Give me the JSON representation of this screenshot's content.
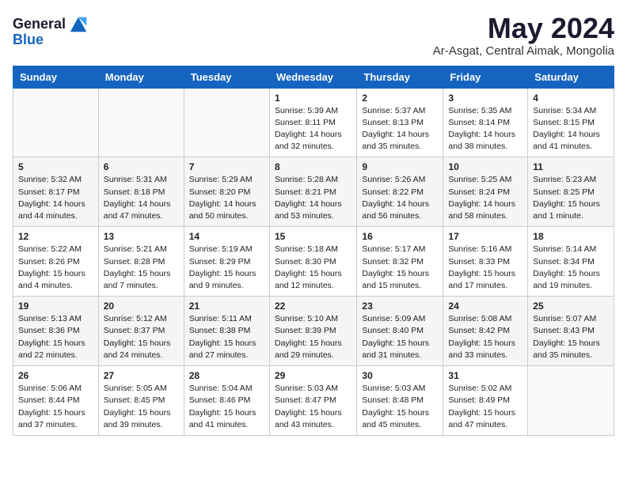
{
  "header": {
    "logo": {
      "general": "General",
      "blue": "Blue"
    },
    "title": "May 2024",
    "location": "Ar-Asgat, Central Aimak, Mongolia"
  },
  "calendar": {
    "days_of_week": [
      "Sunday",
      "Monday",
      "Tuesday",
      "Wednesday",
      "Thursday",
      "Friday",
      "Saturday"
    ],
    "weeks": [
      [
        {
          "day": "",
          "info": ""
        },
        {
          "day": "",
          "info": ""
        },
        {
          "day": "",
          "info": ""
        },
        {
          "day": "1",
          "info": "Sunrise: 5:39 AM\nSunset: 8:11 PM\nDaylight: 14 hours\nand 32 minutes."
        },
        {
          "day": "2",
          "info": "Sunrise: 5:37 AM\nSunset: 8:13 PM\nDaylight: 14 hours\nand 35 minutes."
        },
        {
          "day": "3",
          "info": "Sunrise: 5:35 AM\nSunset: 8:14 PM\nDaylight: 14 hours\nand 38 minutes."
        },
        {
          "day": "4",
          "info": "Sunrise: 5:34 AM\nSunset: 8:15 PM\nDaylight: 14 hours\nand 41 minutes."
        }
      ],
      [
        {
          "day": "5",
          "info": "Sunrise: 5:32 AM\nSunset: 8:17 PM\nDaylight: 14 hours\nand 44 minutes."
        },
        {
          "day": "6",
          "info": "Sunrise: 5:31 AM\nSunset: 8:18 PM\nDaylight: 14 hours\nand 47 minutes."
        },
        {
          "day": "7",
          "info": "Sunrise: 5:29 AM\nSunset: 8:20 PM\nDaylight: 14 hours\nand 50 minutes."
        },
        {
          "day": "8",
          "info": "Sunrise: 5:28 AM\nSunset: 8:21 PM\nDaylight: 14 hours\nand 53 minutes."
        },
        {
          "day": "9",
          "info": "Sunrise: 5:26 AM\nSunset: 8:22 PM\nDaylight: 14 hours\nand 56 minutes."
        },
        {
          "day": "10",
          "info": "Sunrise: 5:25 AM\nSunset: 8:24 PM\nDaylight: 14 hours\nand 58 minutes."
        },
        {
          "day": "11",
          "info": "Sunrise: 5:23 AM\nSunset: 8:25 PM\nDaylight: 15 hours\nand 1 minute."
        }
      ],
      [
        {
          "day": "12",
          "info": "Sunrise: 5:22 AM\nSunset: 8:26 PM\nDaylight: 15 hours\nand 4 minutes."
        },
        {
          "day": "13",
          "info": "Sunrise: 5:21 AM\nSunset: 8:28 PM\nDaylight: 15 hours\nand 7 minutes."
        },
        {
          "day": "14",
          "info": "Sunrise: 5:19 AM\nSunset: 8:29 PM\nDaylight: 15 hours\nand 9 minutes."
        },
        {
          "day": "15",
          "info": "Sunrise: 5:18 AM\nSunset: 8:30 PM\nDaylight: 15 hours\nand 12 minutes."
        },
        {
          "day": "16",
          "info": "Sunrise: 5:17 AM\nSunset: 8:32 PM\nDaylight: 15 hours\nand 15 minutes."
        },
        {
          "day": "17",
          "info": "Sunrise: 5:16 AM\nSunset: 8:33 PM\nDaylight: 15 hours\nand 17 minutes."
        },
        {
          "day": "18",
          "info": "Sunrise: 5:14 AM\nSunset: 8:34 PM\nDaylight: 15 hours\nand 19 minutes."
        }
      ],
      [
        {
          "day": "19",
          "info": "Sunrise: 5:13 AM\nSunset: 8:36 PM\nDaylight: 15 hours\nand 22 minutes."
        },
        {
          "day": "20",
          "info": "Sunrise: 5:12 AM\nSunset: 8:37 PM\nDaylight: 15 hours\nand 24 minutes."
        },
        {
          "day": "21",
          "info": "Sunrise: 5:11 AM\nSunset: 8:38 PM\nDaylight: 15 hours\nand 27 minutes."
        },
        {
          "day": "22",
          "info": "Sunrise: 5:10 AM\nSunset: 8:39 PM\nDaylight: 15 hours\nand 29 minutes."
        },
        {
          "day": "23",
          "info": "Sunrise: 5:09 AM\nSunset: 8:40 PM\nDaylight: 15 hours\nand 31 minutes."
        },
        {
          "day": "24",
          "info": "Sunrise: 5:08 AM\nSunset: 8:42 PM\nDaylight: 15 hours\nand 33 minutes."
        },
        {
          "day": "25",
          "info": "Sunrise: 5:07 AM\nSunset: 8:43 PM\nDaylight: 15 hours\nand 35 minutes."
        }
      ],
      [
        {
          "day": "26",
          "info": "Sunrise: 5:06 AM\nSunset: 8:44 PM\nDaylight: 15 hours\nand 37 minutes."
        },
        {
          "day": "27",
          "info": "Sunrise: 5:05 AM\nSunset: 8:45 PM\nDaylight: 15 hours\nand 39 minutes."
        },
        {
          "day": "28",
          "info": "Sunrise: 5:04 AM\nSunset: 8:46 PM\nDaylight: 15 hours\nand 41 minutes."
        },
        {
          "day": "29",
          "info": "Sunrise: 5:03 AM\nSunset: 8:47 PM\nDaylight: 15 hours\nand 43 minutes."
        },
        {
          "day": "30",
          "info": "Sunrise: 5:03 AM\nSunset: 8:48 PM\nDaylight: 15 hours\nand 45 minutes."
        },
        {
          "day": "31",
          "info": "Sunrise: 5:02 AM\nSunset: 8:49 PM\nDaylight: 15 hours\nand 47 minutes."
        },
        {
          "day": "",
          "info": ""
        }
      ]
    ]
  }
}
